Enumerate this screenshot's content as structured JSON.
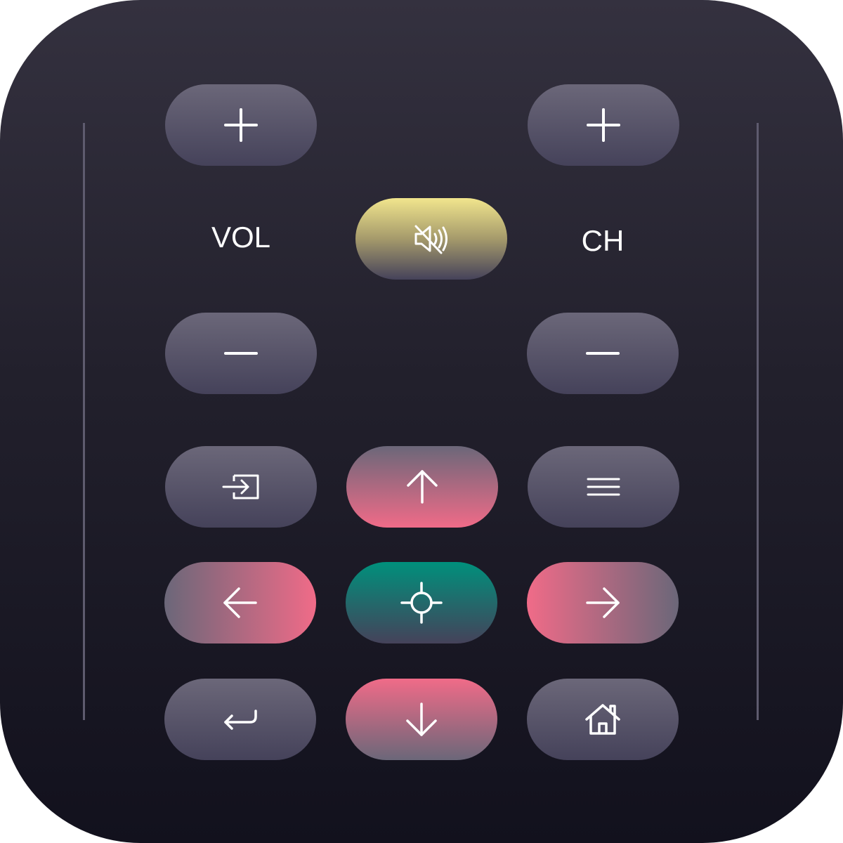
{
  "labels": {
    "volume": "VOL",
    "channel": "CH"
  },
  "icons": {
    "vol_up": "plus-icon",
    "ch_up": "plus-icon",
    "mute": "mute-icon",
    "vol_down": "minus-icon",
    "ch_down": "minus-icon",
    "input": "input-source-icon",
    "up": "arrow-up-icon",
    "menu": "menu-icon",
    "left": "arrow-left-icon",
    "ok": "crosshair-icon",
    "right": "arrow-right-icon",
    "back": "return-icon",
    "down": "arrow-down-icon",
    "home": "home-icon"
  },
  "colors": {
    "body_top": "#34313f",
    "body_bottom": "#12111d",
    "button_top": "#6b6779",
    "button_bottom": "#45425a",
    "pink": "#f06b88",
    "teal": "#00907c",
    "yellow": "#f1e58d",
    "icon": "#ffffff",
    "rail": "#5e5b6e"
  }
}
